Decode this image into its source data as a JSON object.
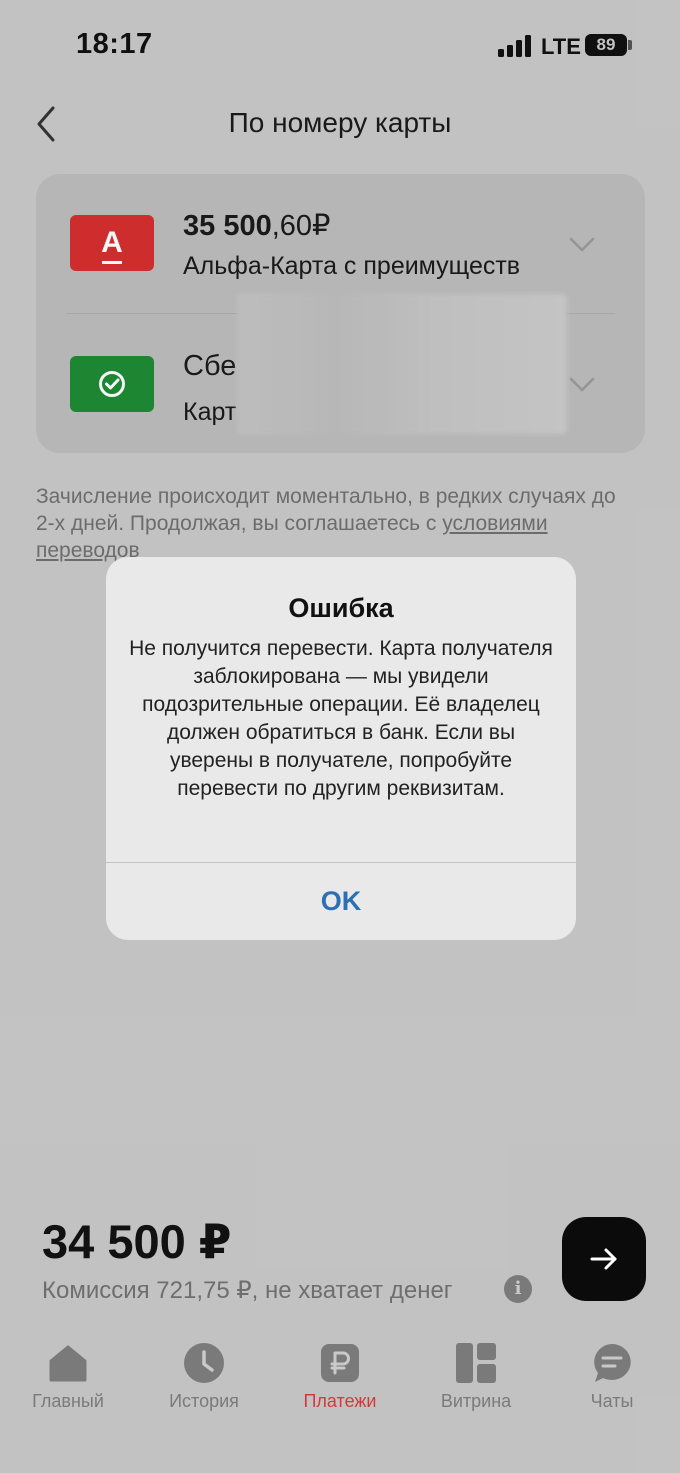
{
  "status_bar": {
    "time": "18:17",
    "network": "LTE",
    "battery": "89"
  },
  "header": {
    "title": "По номеру карты",
    "back_icon": "chevron-left-icon"
  },
  "from_account": {
    "balance_whole": "35 500",
    "balance_fraction": ",60",
    "currency": "₽",
    "name": "Альфа-Карта с преимуществ"
  },
  "to_account": {
    "title": "Сбе",
    "subtitle": "Карт"
  },
  "disclaimer": {
    "text_before": "Зачисление происходит моментально, в редких случаях до 2-х дней. Продолжая, вы соглашаетесь с ",
    "link": "условиями переводов"
  },
  "alert": {
    "title": "Ошибка",
    "message": "Не получится перевести. Карта получателя заблокирована — мы увидели подозрительные операции. Её владелец должен обратиться в банк. Если вы уверены в получателе, попробуйте перевести по другим реквизитам.",
    "ok_label": "OK"
  },
  "transfer": {
    "amount": "34 500 ₽",
    "commission": "Комиссия 721,75 ₽, не хватает денег"
  },
  "tabs": [
    {
      "label": "Главный",
      "icon": "home-icon"
    },
    {
      "label": "История",
      "icon": "clock-icon"
    },
    {
      "label": "Платежи",
      "icon": "ruble-icon",
      "active": true
    },
    {
      "label": "Витрина",
      "icon": "grid-icon"
    },
    {
      "label": "Чаты",
      "icon": "chat-icon"
    }
  ],
  "colors": {
    "alfa_red": "#d42f2f",
    "sber_green": "#1e8b35",
    "ok_blue": "#2d6fb5",
    "active_tab": "#d23a3a"
  }
}
